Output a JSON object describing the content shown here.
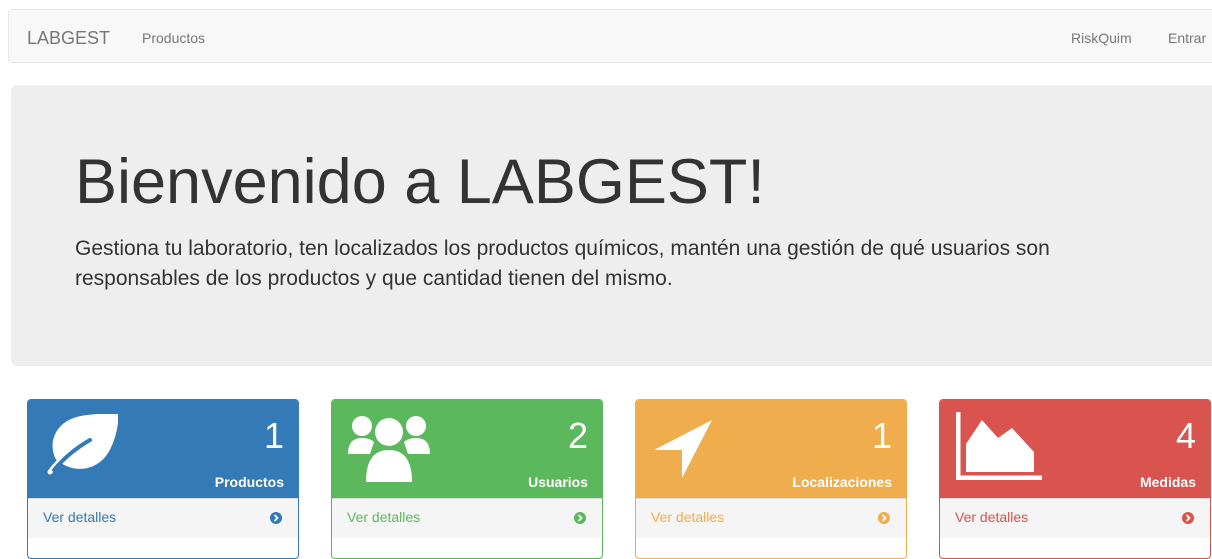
{
  "navbar": {
    "brand": "LABGEST",
    "left_items": [
      "Productos"
    ],
    "right_items": [
      "RiskQuim",
      "Entrar"
    ]
  },
  "jumbotron": {
    "title": "Bienvenido a LABGEST!",
    "text": "Gestiona tu laboratorio, ten localizados los productos químicos, mantén una gestión de qué usuarios son responsables de los productos y que cantidad tienen del mismo."
  },
  "panels": [
    {
      "count": "1",
      "label": "Productos",
      "link": "Ver detalles",
      "icon": "leaf-icon",
      "color": "#337ab7",
      "border": "#337ab7"
    },
    {
      "count": "2",
      "label": "Usuarios",
      "link": "Ver detalles",
      "icon": "users-icon",
      "color": "#5cb85c",
      "border": "#5cb85c"
    },
    {
      "count": "1",
      "label": "Localizaciones",
      "link": "Ver detalles",
      "icon": "location-arrow-icon",
      "color": "#f0ad4e",
      "border": "#f0ad4e"
    },
    {
      "count": "4",
      "label": "Medidas",
      "link": "Ver detalles",
      "icon": "area-chart-icon",
      "color": "#d9534f",
      "border": "#d9534f"
    }
  ]
}
